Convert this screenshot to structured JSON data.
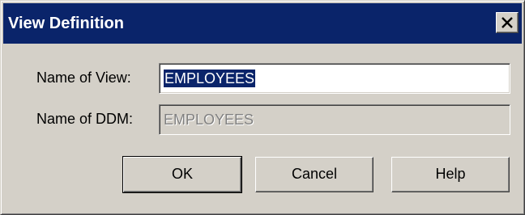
{
  "dialog": {
    "title": "View Definition",
    "close_glyph": "close-icon"
  },
  "fields": {
    "view_label": "Name of View:",
    "view_value": "EMPLOYEES",
    "ddm_label": "Name of DDM:",
    "ddm_value": "EMPLOYEES"
  },
  "buttons": {
    "ok_label": "OK",
    "cancel_label": "Cancel",
    "help_label": "Help"
  },
  "colors": {
    "titlebar": "#0a246a",
    "face": "#d4d0c8",
    "selection": "#0a246a"
  }
}
